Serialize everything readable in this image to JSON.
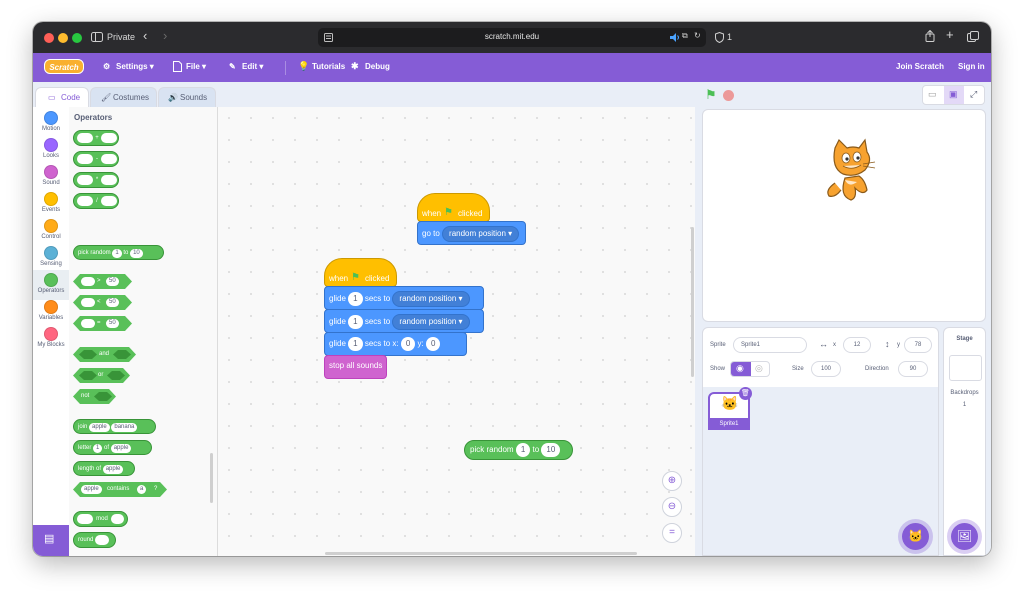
{
  "browser": {
    "private_label": "Private",
    "url": "scratch.mit.edu",
    "shield_count": "1"
  },
  "menu": {
    "logo": "Scratch",
    "settings": "Settings",
    "file": "File",
    "edit": "Edit",
    "tutorials": "Tutorials",
    "debug": "Debug",
    "join": "Join Scratch",
    "signin": "Sign in"
  },
  "tabs": {
    "code": "Code",
    "costumes": "Costumes",
    "sounds": "Sounds"
  },
  "categories": [
    {
      "label": "Motion",
      "color": "#4c97ff"
    },
    {
      "label": "Looks",
      "color": "#9966ff"
    },
    {
      "label": "Sound",
      "color": "#cf63cf"
    },
    {
      "label": "Events",
      "color": "#ffbf00"
    },
    {
      "label": "Control",
      "color": "#ffab19"
    },
    {
      "label": "Sensing",
      "color": "#5cb1d6"
    },
    {
      "label": "Operators",
      "color": "#59c059"
    },
    {
      "label": "Variables",
      "color": "#ff8c1a"
    },
    {
      "label": "My Blocks",
      "color": "#ff6680"
    }
  ],
  "palette": {
    "title": "Operators",
    "arith": [
      "+",
      "-",
      "*",
      "/"
    ],
    "pick_random": {
      "label": "pick random",
      "from": "1",
      "to_label": "to",
      "to": "10"
    },
    "compare": [
      {
        "op": ">",
        "value": "50"
      },
      {
        "op": "<",
        "value": "50"
      },
      {
        "op": "=",
        "value": "50"
      }
    ],
    "bool_and": "and",
    "bool_or": "or",
    "bool_not": "not",
    "join": {
      "label": "join",
      "a": "apple",
      "b": "banana"
    },
    "letter": {
      "label": "letter",
      "n": "1",
      "of": "of",
      "word": "apple"
    },
    "length": {
      "label": "length of",
      "word": "apple"
    },
    "contains": {
      "word": "apple",
      "label": "contains",
      "letter": "a",
      "q": "?"
    },
    "mod": "mod",
    "round": "round",
    "abs": {
      "fn": "abs",
      "of": "of"
    }
  },
  "scripts": {
    "script1": {
      "hat": {
        "when": "when",
        "clicked": "clicked"
      },
      "goto": {
        "label": "go to",
        "target": "random position"
      }
    },
    "script2": {
      "hat": {
        "when": "when",
        "clicked": "clicked"
      },
      "glide1": {
        "label": "glide",
        "secs": "1",
        "secs_to": "secs to",
        "target": "random position"
      },
      "glide2": {
        "label": "glide",
        "secs": "1",
        "secs_to": "secs to",
        "target": "random position"
      },
      "glide3": {
        "label": "glide",
        "secs": "1",
        "secs_to_x": "secs to x:",
        "x": "0",
        "y_label": "y:",
        "y": "0"
      },
      "stop": "stop all sounds"
    },
    "loose_pick": {
      "label": "pick random",
      "from": "1",
      "to_label": "to",
      "to": "10"
    }
  },
  "sprite": {
    "sprite_label": "Sprite",
    "name": "Sprite1",
    "x_label": "x",
    "x": "12",
    "y_label": "y",
    "y": "78",
    "show_label": "Show",
    "size_label": "Size",
    "size": "100",
    "direction_label": "Direction",
    "direction": "90",
    "thumb_name": "Sprite1"
  },
  "stage_panel": {
    "title": "Stage",
    "backdrops_label": "Backdrops",
    "backdrops_count": "1"
  },
  "colors": {
    "accent": "#855cd6",
    "operators": "#59c059",
    "events": "#ffbf00",
    "motion": "#4c97ff",
    "sound": "#cf63cf"
  }
}
